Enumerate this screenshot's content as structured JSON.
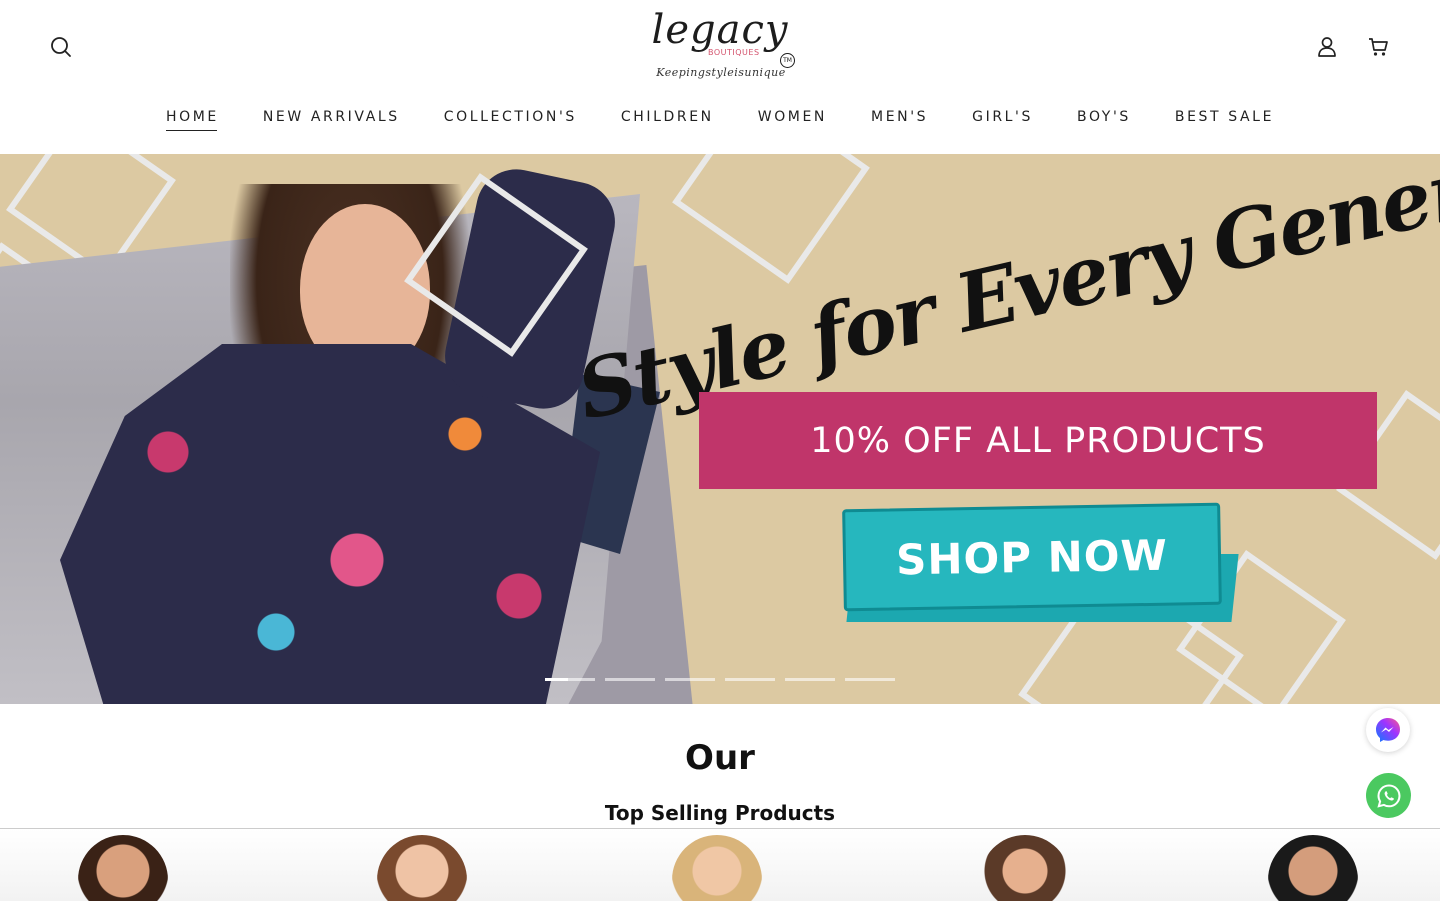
{
  "header": {
    "logo": {
      "wordmark": "legacy",
      "sub_mark": "BOUTIQUES",
      "trademark": "TM",
      "tagline": "Keepingstyleisunique"
    },
    "icons": {
      "search": "search-icon",
      "account": "user-icon",
      "cart": "cart-icon"
    }
  },
  "nav": {
    "items": [
      {
        "label": "HOME",
        "active": true
      },
      {
        "label": "NEW ARRIVALS"
      },
      {
        "label": "COLLECTION'S"
      },
      {
        "label": "CHILDREN"
      },
      {
        "label": "WOMEN"
      },
      {
        "label": "MEN'S"
      },
      {
        "label": "GIRL'S"
      },
      {
        "label": "BOY'S"
      },
      {
        "label": "BEST SALE"
      }
    ]
  },
  "hero": {
    "headline": "Style for Every Generation",
    "offer": "10% OFF ALL  PRODUCTS",
    "cta": "SHOP NOW",
    "slide_count": 6,
    "active_slide": 1,
    "colors": {
      "background": "#dcc9a2",
      "offer": "#c0356a",
      "cta": "#26b7be"
    }
  },
  "section": {
    "title": "Our",
    "subtitle": "Top Selling Products"
  },
  "floating": {
    "messenger": "messenger-icon",
    "whatsapp": "whatsapp-icon",
    "whatsapp_color": "#4bc960"
  }
}
